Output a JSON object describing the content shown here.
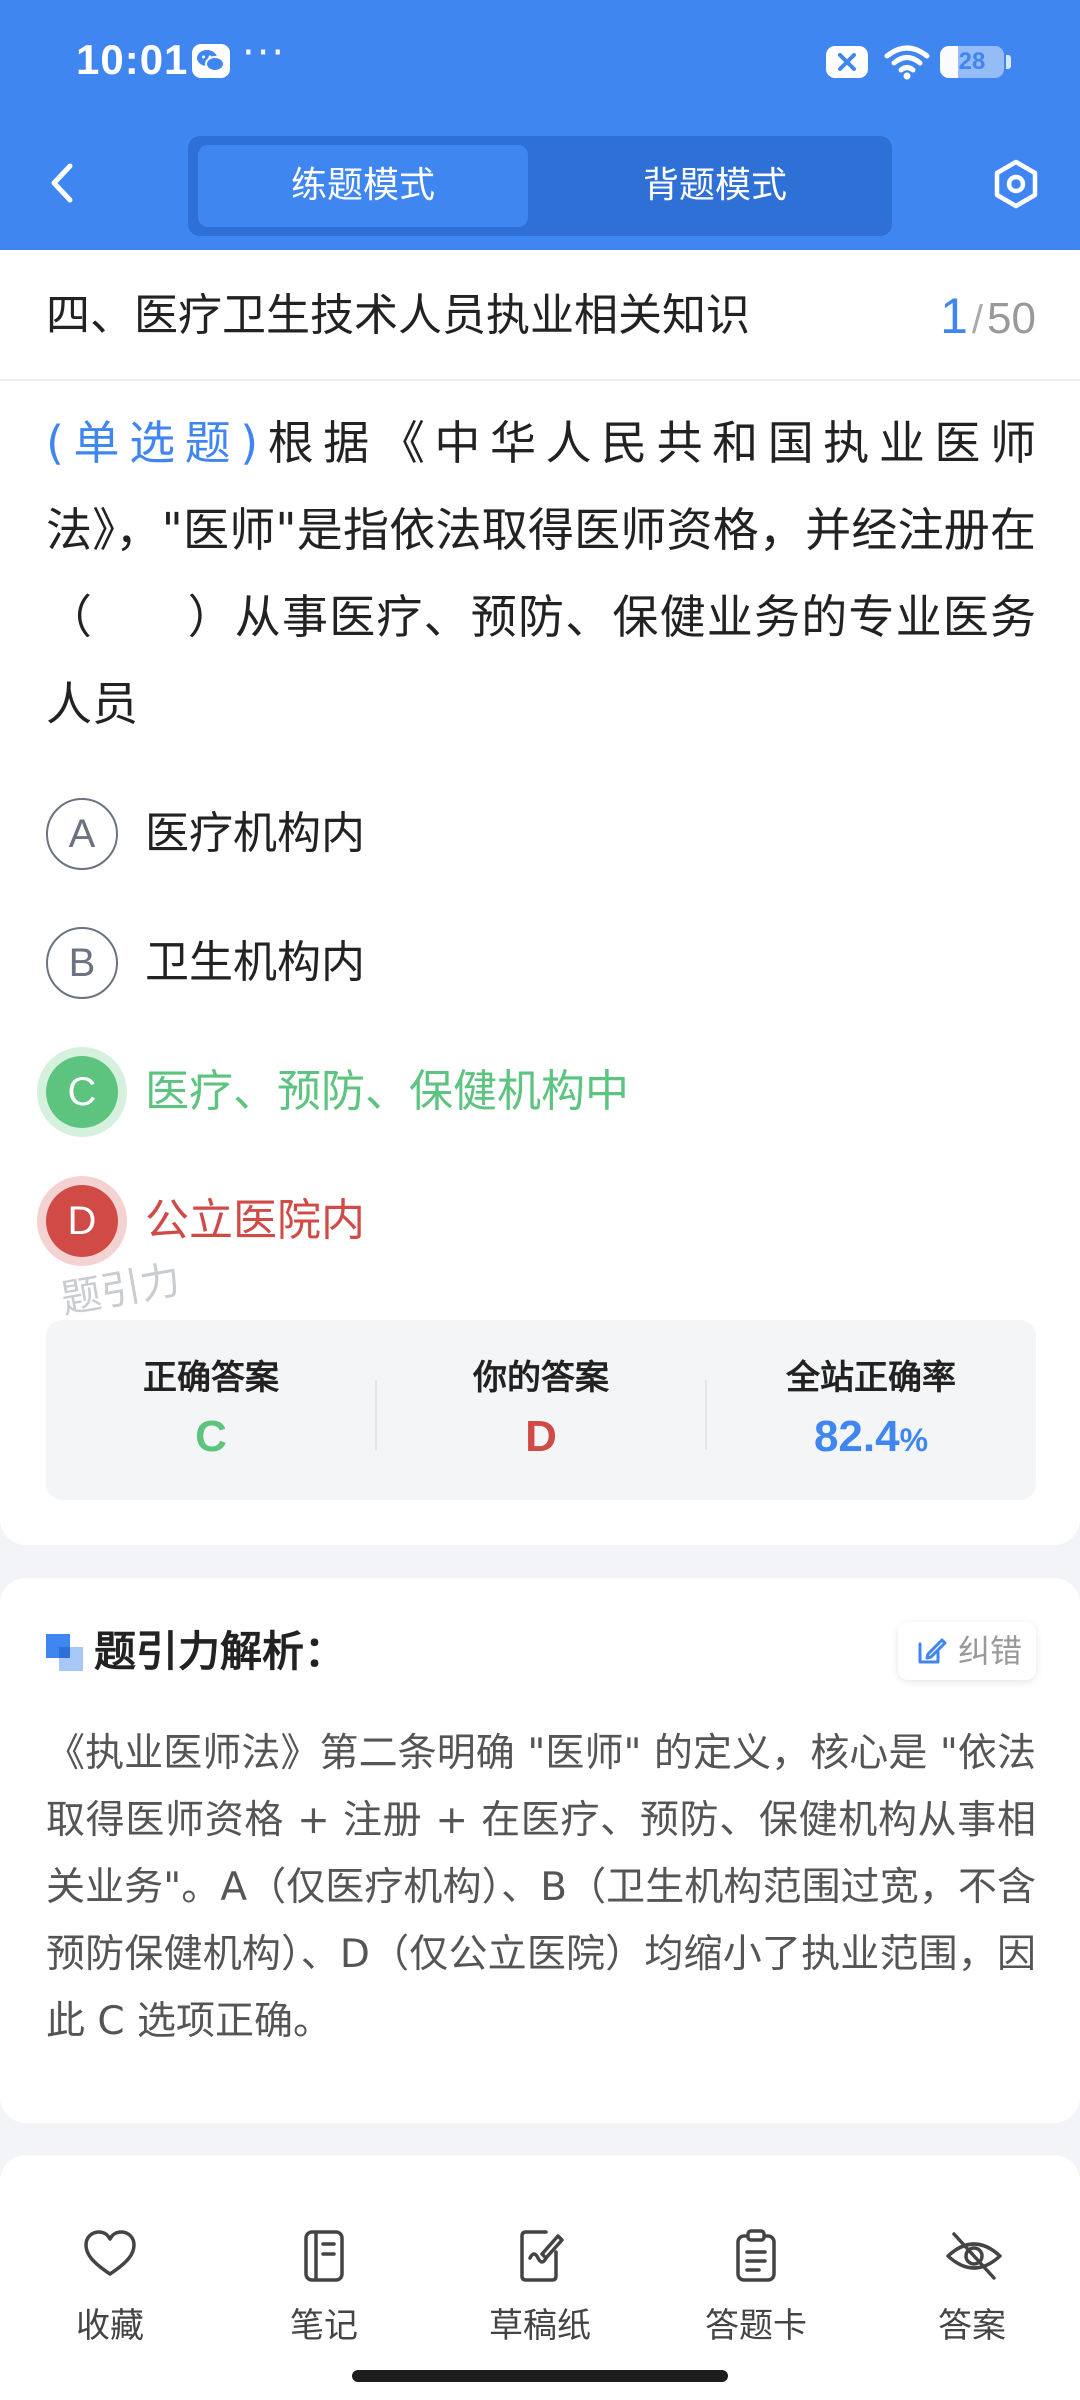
{
  "status_bar": {
    "time": "10:01",
    "more": "···",
    "battery_level": "28",
    "battery_fraction": 0.28
  },
  "nav": {
    "modes": [
      "练题模式",
      "背题模式"
    ],
    "active_mode": "练题模式"
  },
  "question_header": {
    "section_title": "四、医疗卫生技术人员执业相关知识",
    "current": "1",
    "separator": "/",
    "total": "50"
  },
  "question": {
    "type": "(单选题)",
    "text": "根据《中华人民共和国执业医师法》，\"医师\"是指依法取得医师资格，并经注册在（　　）从事医疗、预防、保健业务的专业医务人员",
    "options": [
      {
        "letter": "A",
        "text": "医疗机构内",
        "state": "normal"
      },
      {
        "letter": "B",
        "text": "卫生机构内",
        "state": "normal"
      },
      {
        "letter": "C",
        "text": "医疗、预防、保健机构中",
        "state": "correct"
      },
      {
        "letter": "D",
        "text": "公立医院内",
        "state": "wrong"
      }
    ]
  },
  "watermark": "题引力",
  "stats": {
    "correct_label": "正确答案",
    "correct_value": "C",
    "yours_label": "你的答案",
    "yours_value": "D",
    "rate_label": "全站正确率",
    "rate_value": "82.4",
    "rate_unit": "%"
  },
  "analysis": {
    "title": "题引力解析：",
    "fix_label": "纠错",
    "text": "《执业医师法》第二条明确 \"医师\" 的定义，核心是 \"依法取得医师资格 + 注册 + 在医疗、预防、保健机构从事相关业务\"。A（仅医疗机构）、B（卫生机构范围过宽，不含预防保健机构）、D（仅公立医院）均缩小了执业范围，因此 C 选项正确。"
  },
  "toolbar": {
    "favorite": "收藏",
    "notes": "笔记",
    "draft": "草稿纸",
    "answer_card": "答题卡",
    "answer": "答案"
  },
  "colors": {
    "brand": "#3f86f0",
    "correct": "#5cc47e",
    "wrong": "#d04a46"
  }
}
